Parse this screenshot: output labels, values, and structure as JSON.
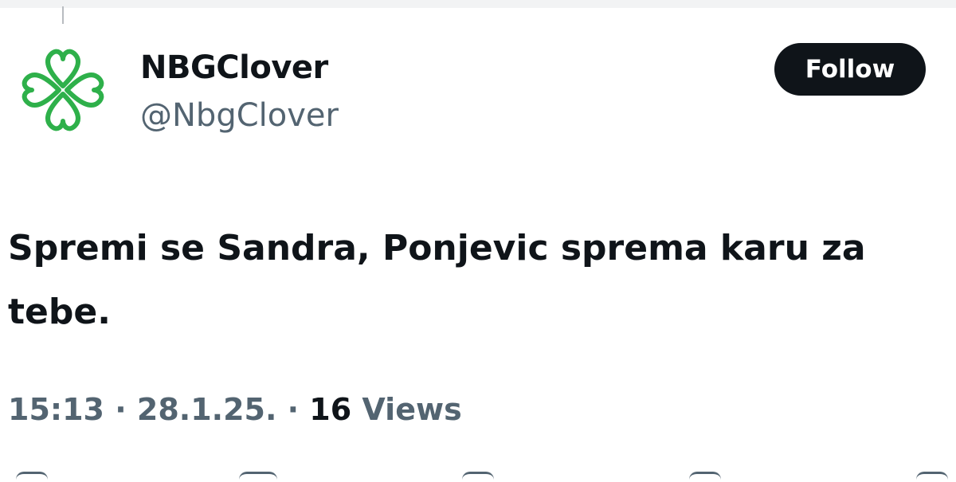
{
  "tweet": {
    "display_name": "NBGClover",
    "handle": "@NbgClover",
    "follow_label": "Follow",
    "text": "Spremi se Sandra, Ponjevic sprema karu za tebe.",
    "time": "15:13",
    "separator": "·",
    "date": "28.1.25.",
    "views_count": "16",
    "views_label": "Views"
  },
  "colors": {
    "avatar_green": "#2eb04a",
    "follow_bg": "#0f1419",
    "secondary_text": "#536471"
  },
  "icons": {
    "avatar": "four-leaf-clover-logo",
    "actions": [
      "reply-icon",
      "repost-icon",
      "like-icon",
      "views-icon",
      "share-icon"
    ]
  }
}
